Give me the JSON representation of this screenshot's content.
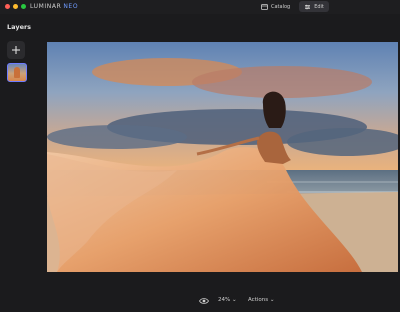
{
  "window": {
    "brand_name": "LUMINAR",
    "brand_suffix": "NEO",
    "traffic_lights": [
      "#ff5f57",
      "#febc2e",
      "#28c840"
    ]
  },
  "topnav": {
    "catalog_label": "Catalog",
    "catalog_icon": "catalog-icon",
    "edit_label": "Edit",
    "edit_icon": "edit-icon",
    "active_tab": "Edit"
  },
  "sidebar": {
    "title": "Layers",
    "add_icon": "plus-icon",
    "layers": [
      {
        "thumbnail": "photo-thumbnail",
        "selected": true
      }
    ]
  },
  "bottombar": {
    "visibility_icon": "eye-icon",
    "zoom_label": "24%",
    "actions_label": "Actions",
    "chevron_icon": "chevron-down-icon"
  },
  "colors": {
    "background": "#1b1b1d",
    "accent": "#6e7cff",
    "brand_neo": "#6f9bff"
  }
}
